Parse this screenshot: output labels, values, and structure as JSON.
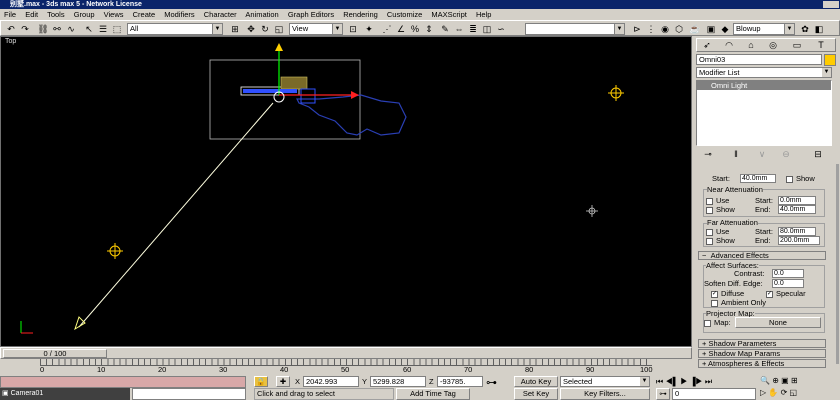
{
  "window": {
    "title": "别墅.max - 3ds max 5 - Network License"
  },
  "menu": [
    "File",
    "Edit",
    "Tools",
    "Group",
    "Views",
    "Create",
    "Modifiers",
    "Character",
    "Animation",
    "Graph Editors",
    "Rendering",
    "Customize",
    "MAXScript",
    "Help"
  ],
  "toolbar": {
    "selection_filter": "All",
    "coord_system": "View",
    "named_selection": "",
    "render_type": "Blowup"
  },
  "viewport": {
    "label": "Top"
  },
  "command_panel": {
    "object_name": "Omni03",
    "object_color": "#ffcc00",
    "modifier_list_label": "Modifier List",
    "stack_item": "Omni Light",
    "start_label": "Start:",
    "start_value": "40.0mm",
    "show_label": "Show",
    "near_title": "Near Attenuation",
    "near_use": "Use",
    "near_show": "Show",
    "near_start_label": "Start:",
    "near_start": "0.0mm",
    "near_end_label": "End:",
    "near_end": "40.0mm",
    "far_title": "Far Attenuation",
    "far_use": "Use",
    "far_show": "Show",
    "far_start_label": "Start:",
    "far_start": "80.0mm",
    "far_end_label": "End:",
    "far_end": "200.0mm",
    "advanced_title": "Advanced Effects",
    "affect_surfaces": "Affect Surfaces:",
    "contrast_label": "Contrast:",
    "contrast_value": "0.0",
    "soften_label": "Soften Diff. Edge:",
    "soften_value": "0.0",
    "diffuse_label": "Diffuse",
    "specular_label": "Specular",
    "ambient_label": "Ambient Only",
    "projector_title": "Projector Map:",
    "map_label": "Map:",
    "map_value": "None",
    "rollout_shadow_params": "+  Shadow Parameters",
    "rollout_shadow_map": "+  Shadow Map Params",
    "rollout_atmos": "+  Atmospheres & Effects"
  },
  "timeslider": {
    "label": "0 / 100",
    "ticks": [
      "0",
      "10",
      "20",
      "30",
      "40",
      "50",
      "60",
      "70",
      "80",
      "90",
      "100"
    ]
  },
  "status": {
    "viewport_name": "Camera01",
    "x_label": "X",
    "x_value": "2042.993",
    "y_label": "Y",
    "y_value": "5299.828",
    "z_label": "Z",
    "z_value": "-93785.",
    "prompt": "Click and drag to select",
    "add_time_tag": "Add Time Tag",
    "auto_key": "Auto Key",
    "set_key": "Set Key",
    "key_mode": "Selected",
    "key_filters": "Key Filters...",
    "frame": "0"
  }
}
